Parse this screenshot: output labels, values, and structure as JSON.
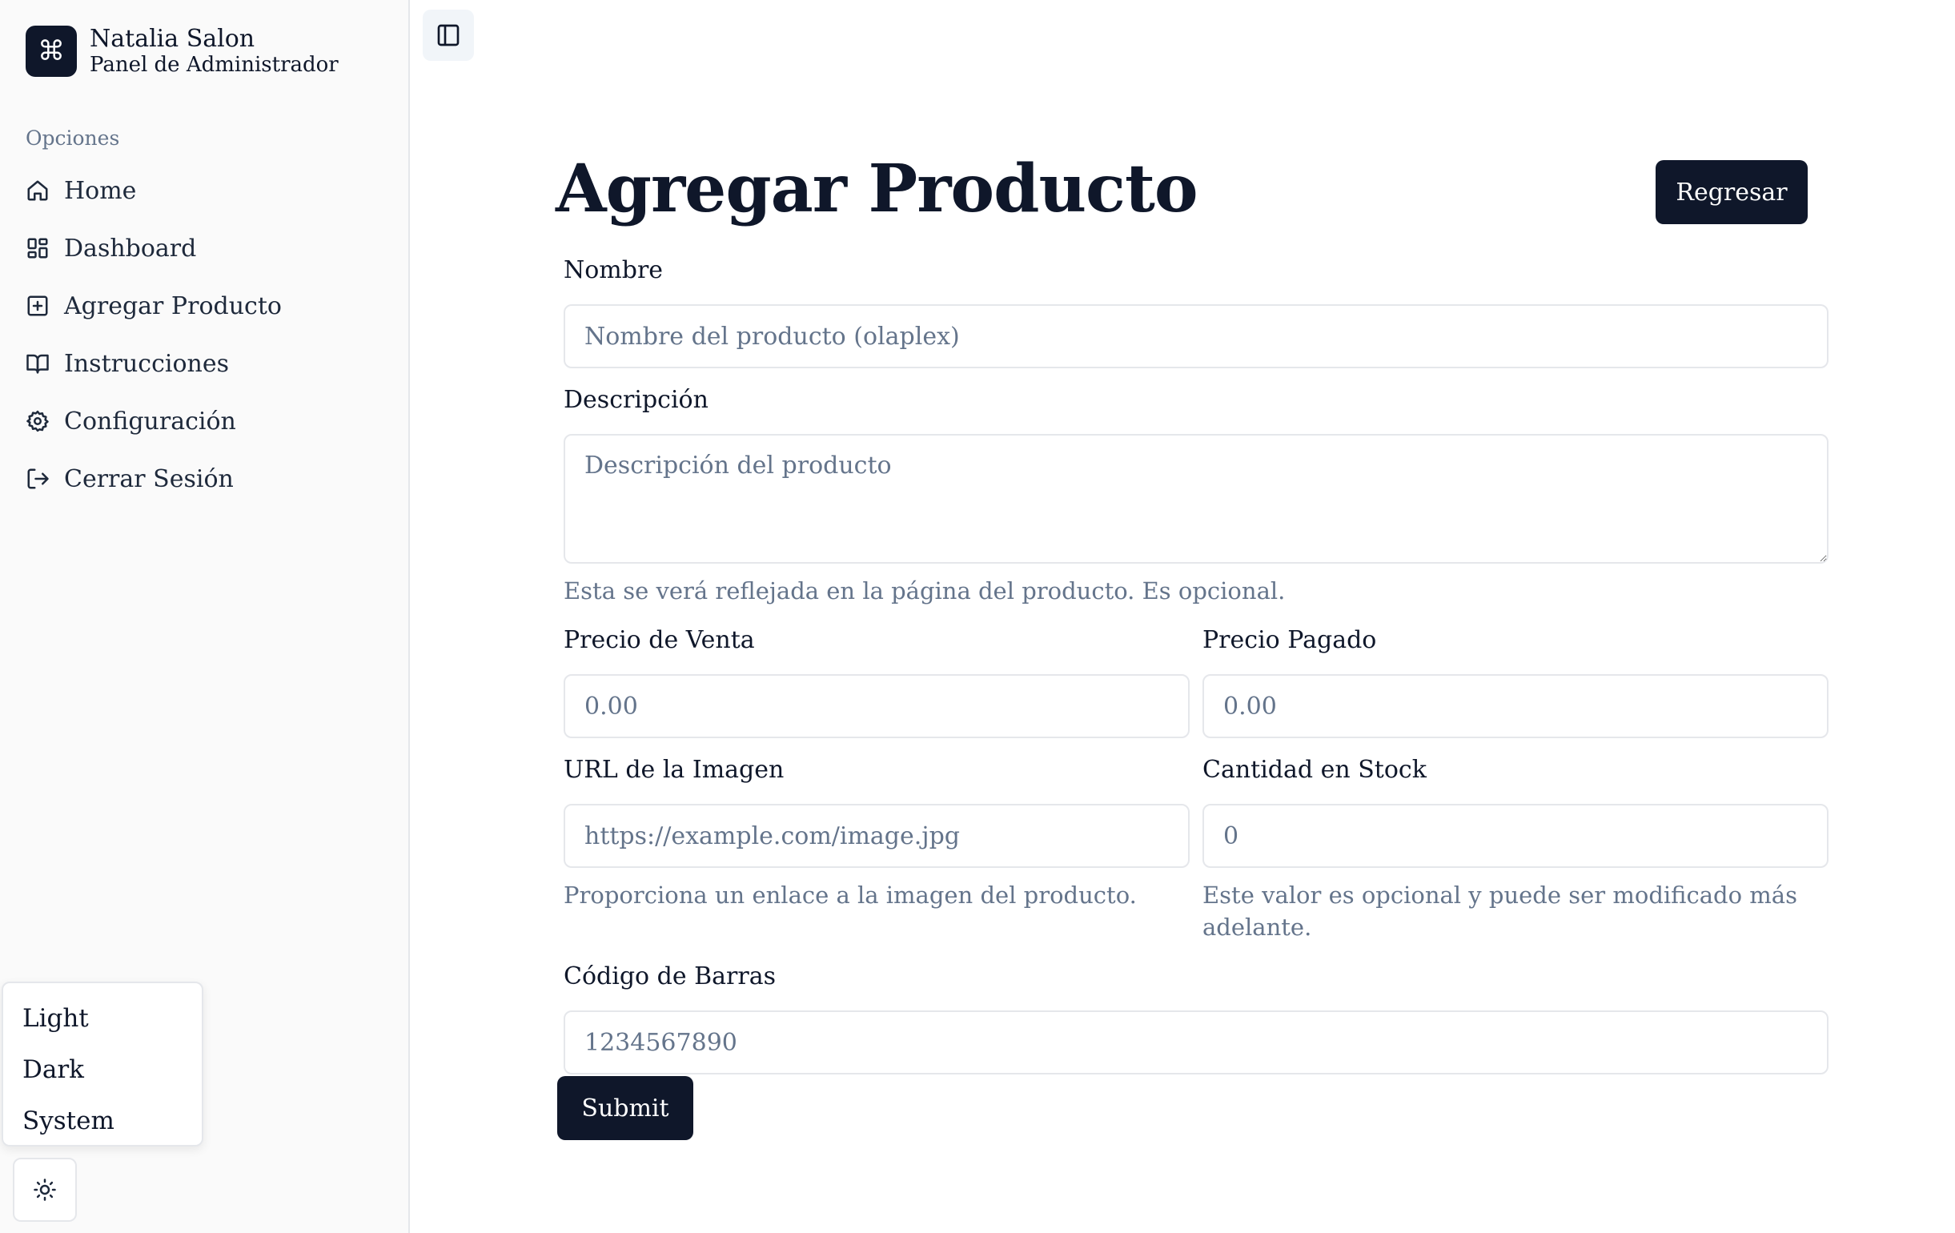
{
  "brand": {
    "logo_glyph": "⌘",
    "title": "Natalia Salon",
    "subtitle": "Panel de Administrador"
  },
  "sidebar": {
    "group_label": "Opciones",
    "items": [
      {
        "label": "Home",
        "icon": "home-icon"
      },
      {
        "label": "Dashboard",
        "icon": "dashboard-icon"
      },
      {
        "label": "Agregar Producto",
        "icon": "plus-square-icon"
      },
      {
        "label": "Instrucciones",
        "icon": "book-open-icon"
      },
      {
        "label": "Configuración",
        "icon": "gear-icon"
      },
      {
        "label": "Cerrar Sesión",
        "icon": "logout-icon"
      }
    ]
  },
  "theme_menu": {
    "options": [
      "Light",
      "Dark",
      "System"
    ],
    "toggle_icon": "sun-icon"
  },
  "header": {
    "title": "Agregar Producto",
    "back_label": "Regresar"
  },
  "form": {
    "nombre": {
      "label": "Nombre",
      "placeholder": "Nombre del producto (olaplex)",
      "value": ""
    },
    "descripcion": {
      "label": "Descripción",
      "placeholder": "Descripción del producto",
      "help": "Esta se verá reflejada en la página del producto. Es opcional.",
      "value": ""
    },
    "precio_venta": {
      "label": "Precio de Venta",
      "placeholder": "0.00",
      "value": ""
    },
    "precio_pagado": {
      "label": "Precio Pagado",
      "placeholder": "0.00",
      "value": ""
    },
    "imagen_url": {
      "label": "URL de la Imagen",
      "placeholder": "https://example.com/image.jpg",
      "help": "Proporciona un enlace a la imagen del producto.",
      "value": ""
    },
    "stock": {
      "label": "Cantidad en Stock",
      "placeholder": "0",
      "help": "Este valor es opcional y puede ser modificado más adelante.",
      "value": ""
    },
    "codigo_barras": {
      "label": "Código de Barras",
      "placeholder": "1234567890",
      "value": ""
    },
    "submit_label": "Submit"
  },
  "colors": {
    "primary": "#0f172a",
    "muted_text": "#64748b",
    "border": "#e5e7eb",
    "sidebar_bg": "#fafafa"
  }
}
